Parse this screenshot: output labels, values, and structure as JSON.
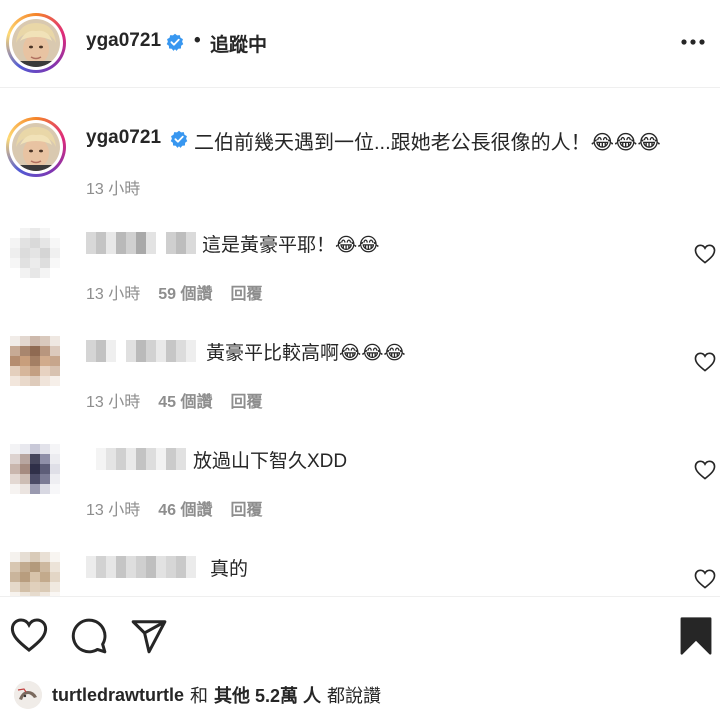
{
  "header": {
    "username": "yga0721",
    "separator": "•",
    "follow_label": "追蹤中"
  },
  "caption": {
    "username": "yga0721",
    "text": "二伯前幾天遇到一位...跟她老公長很像的人！😂😂😂",
    "time": "13 小時"
  },
  "comments": [
    {
      "text": "這是黃豪平耶！😂😂",
      "time": "13 小時",
      "likes": "59 個讚",
      "reply": "回覆"
    },
    {
      "text": "黃豪平比較高啊😂😂😂",
      "time": "13 小時",
      "likes": "45 個讚",
      "reply": "回覆"
    },
    {
      "text": "放過山下智久XDD",
      "time": "13 小時",
      "likes": "46 個讚",
      "reply": "回覆"
    },
    {
      "text": "真的"
    }
  ],
  "likes": {
    "username": "turtledrawturtle",
    "and": "和",
    "others": "其他 5.2萬 人",
    "suffix": "都說讚"
  },
  "colors": {
    "text": "#262626",
    "secondary": "#8e8e8e",
    "verified": "#3897f0",
    "divider": "#efefef"
  },
  "icons": [
    "verified-badge-icon",
    "more-options-icon",
    "heart-icon",
    "comment-icon",
    "share-icon",
    "bookmark-icon"
  ]
}
